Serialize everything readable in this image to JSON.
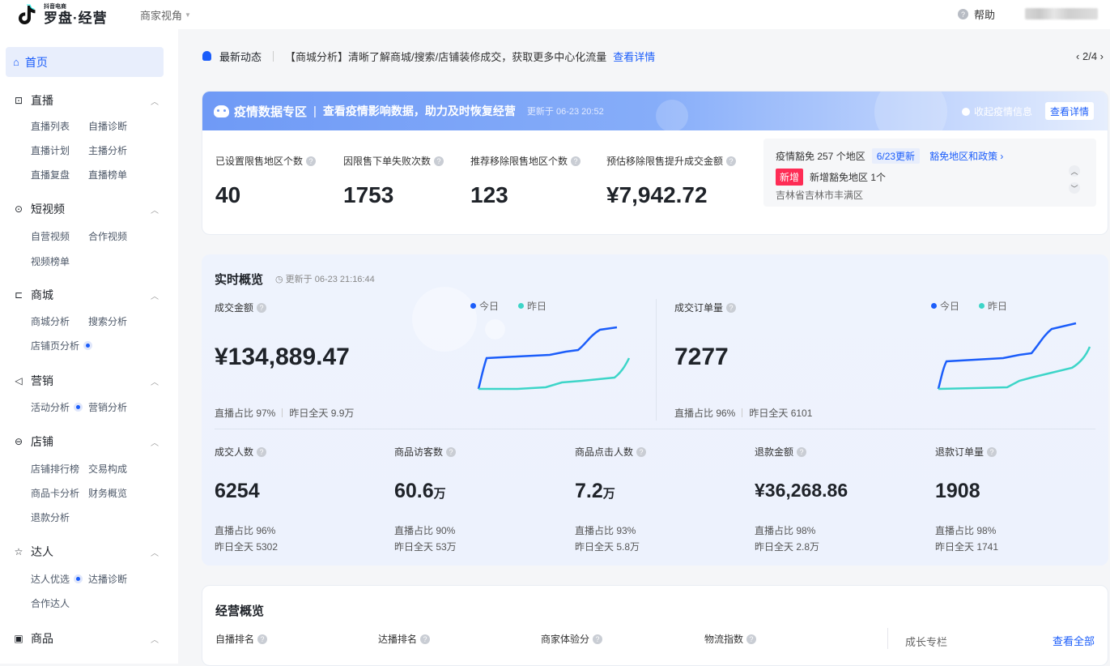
{
  "topbar": {
    "logo_small": "抖音电商",
    "logo_main": "罗盘·经营",
    "view_switch": "商家视角",
    "help": "帮助"
  },
  "sidebar": {
    "home": "首页",
    "sections": [
      {
        "title": "直播",
        "items": [
          "直播列表",
          "自播诊断",
          "直播计划",
          "主播分析",
          "直播复盘",
          "直播榜单"
        ]
      },
      {
        "title": "短视频",
        "items": [
          "自营视频",
          "合作视频",
          "视频榜单"
        ]
      },
      {
        "title": "商城",
        "items": [
          "商城分析",
          "搜索分析",
          "店铺页分析"
        ]
      },
      {
        "title": "营销",
        "items": [
          "活动分析",
          "营销分析"
        ]
      },
      {
        "title": "店铺",
        "items": [
          "店铺排行榜",
          "交易构成",
          "商品卡分析",
          "财务概览",
          "退款分析"
        ]
      },
      {
        "title": "达人",
        "items": [
          "达人优选",
          "达播诊断",
          "合作达人"
        ]
      },
      {
        "title": "商品",
        "items": []
      }
    ]
  },
  "news": {
    "title": "最新动态",
    "text": "【商城分析】清晰了解商城/搜索/店铺装修成交，获取更多中心化流量",
    "link": "查看详情",
    "pager": "‹ 2/4 ›"
  },
  "epidemic": {
    "title": "疫情数据专区",
    "sep": "|",
    "subtitle": "查看疫情影响数据，助力及时恢复经营",
    "updated": "更新于 06-23 20:52",
    "collapse": "收起疫情信息",
    "detail_btn": "查看详情",
    "metrics": [
      {
        "label": "已设置限售地区个数",
        "value": "40"
      },
      {
        "label": "因限售下单失败次数",
        "value": "1753"
      },
      {
        "label": "推荐移除限售地区个数",
        "value": "123"
      },
      {
        "label": "预估移除限售提升成交金额",
        "value": "¥7,942.72"
      }
    ],
    "zone": {
      "line1": "疫情豁免 257 个地区",
      "badge": "6/23更新",
      "link": "豁免地区和政策 ›",
      "new_badge": "新增",
      "line2": "新增豁免地区 1个",
      "line3": "吉林省吉林市丰满区"
    }
  },
  "realtime": {
    "title": "实时概览",
    "updated": "更新于 06-23 21:16:44",
    "legend_today": "今日",
    "legend_yesterday": "昨日",
    "colors": {
      "today": "#1b5dfa",
      "yesterday": "#3dd5c8"
    },
    "gmv": {
      "label": "成交金额",
      "value": "¥134,889.47",
      "live_ratio": "直播占比 97%",
      "yesterday": "昨日全天 9.9万"
    },
    "orders": {
      "label": "成交订单量",
      "value": "7277",
      "live_ratio": "直播占比 96%",
      "yesterday": "昨日全天 6101"
    },
    "kpis": [
      {
        "label": "成交人数",
        "value": "6254",
        "unit": "",
        "live_ratio": "直播占比 96%",
        "yesterday": "昨日全天 5302"
      },
      {
        "label": "商品访客数",
        "value": "60.6",
        "unit": "万",
        "live_ratio": "直播占比 90%",
        "yesterday": "昨日全天 53万"
      },
      {
        "label": "商品点击人数",
        "value": "7.2",
        "unit": "万",
        "live_ratio": "直播占比 93%",
        "yesterday": "昨日全天 5.8万"
      },
      {
        "label": "退款金额",
        "value": "¥36,268.86",
        "unit": "",
        "live_ratio": "直播占比 98%",
        "yesterday": "昨日全天 2.8万"
      },
      {
        "label": "退款订单量",
        "value": "1908",
        "unit": "",
        "live_ratio": "直播占比 98%",
        "yesterday": "昨日全天 1741"
      }
    ]
  },
  "overview": {
    "title": "经营概览",
    "items": [
      "自播排名",
      "达播排名",
      "商家体验分",
      "物流指数"
    ],
    "growth": "成长专栏",
    "view_all": "查看全部"
  }
}
